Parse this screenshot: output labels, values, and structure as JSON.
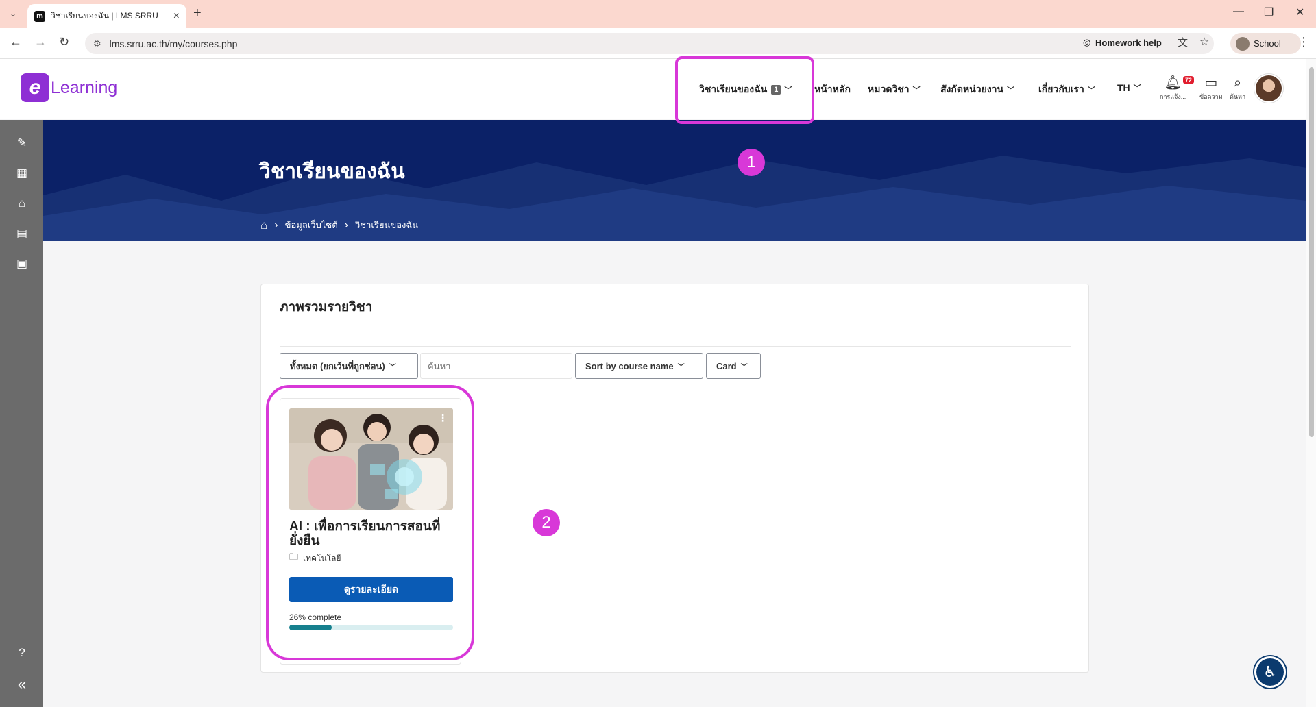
{
  "browser": {
    "tab_title": "วิชาเรียนของฉัน | LMS SRRU",
    "favicon_letter": "m",
    "url": "lms.srru.ac.th/my/courses.php",
    "homework_help": "Homework help",
    "profile_label": "School"
  },
  "header": {
    "logo_mark": "e",
    "logo_word": "Learning",
    "nav": {
      "my_courses": "วิชาเรียนของฉัน",
      "my_courses_badge": "1",
      "home": "หน้าหลัก",
      "categories": "หมวดวิชา",
      "departments": "สังกัดหน่วยงาน",
      "about": "เกี่ยวกับเรา",
      "language": "TH"
    },
    "icons": {
      "notifications_label": "การแจ้ง...",
      "notifications_count": "72",
      "messages_label": "ข้อความ",
      "search_label": "ค้นหา"
    }
  },
  "hero": {
    "title": "วิชาเรียนของฉัน",
    "breadcrumb": [
      "ข้อมูลเว็บไซต์",
      "วิชาเรียนของฉัน"
    ]
  },
  "course_overview": {
    "title": "ภาพรวมรายวิชา",
    "filter_label": "ทั้งหมด (ยกเว้นที่ถูกซ่อน)",
    "search_placeholder": "ค้นหา",
    "sort_label": "Sort by course name",
    "view_label": "Card",
    "courses": [
      {
        "name": "AI : เพื่อการเรียนการสอนที่ยั่งยืน",
        "category": "เทคโนโลยี",
        "button_label": "ดูรายละเอียด",
        "progress_text": "26% complete",
        "progress": 26
      }
    ]
  },
  "annotations": {
    "marker_1": "1",
    "marker_2": "2",
    "color": "#d838d8"
  },
  "colors": {
    "brand_purple": "#8e2fd4",
    "hero_navy": "#0b2167",
    "button_blue": "#0a5bb5",
    "progress_teal": "#16808e"
  }
}
